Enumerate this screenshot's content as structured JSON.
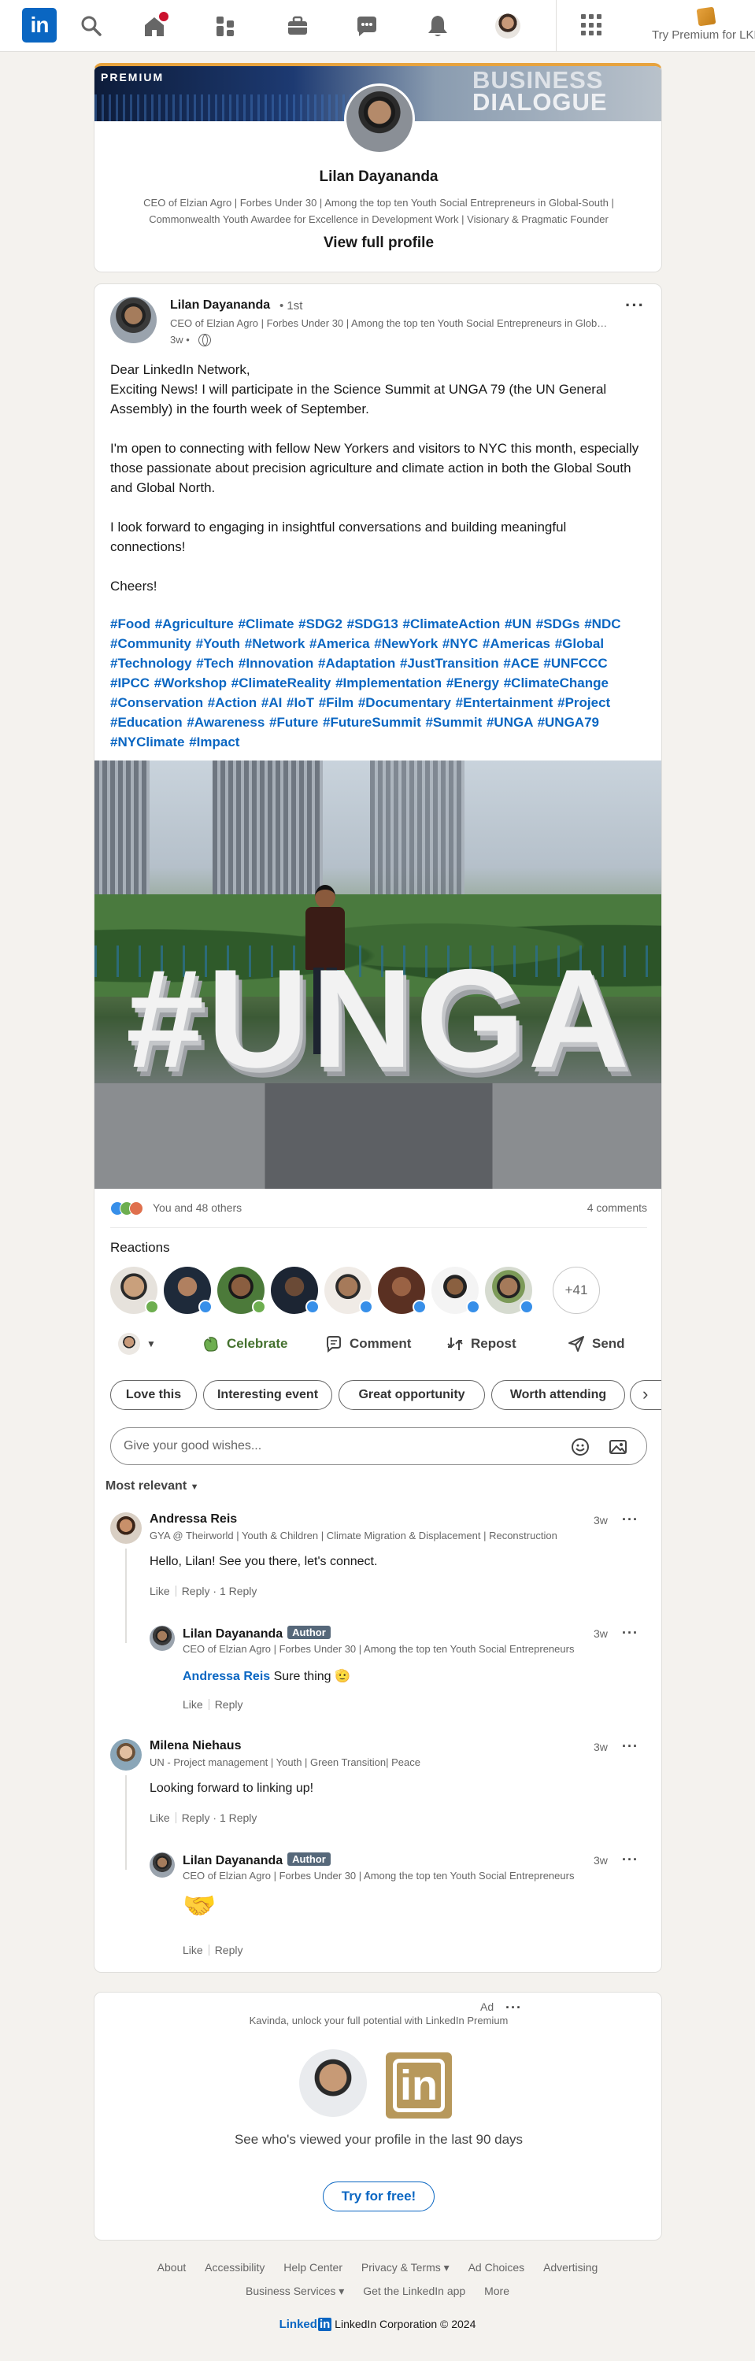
{
  "nav": {
    "logo": "in",
    "premium_cta": "Try Premium for LKR"
  },
  "profile": {
    "banner_label": "PREMIUM",
    "banner_line1": "BUSINESS",
    "banner_line2": "DIALOGUE",
    "name": "Lilan Dayananda",
    "headline": "CEO of Elzian Agro | Forbes Under 30 | Among the top ten Youth Social Entrepreneurs in Global-South | Commonwealth Youth Awardee for Excellence in Development Work | Visionary & Pragmatic Founder",
    "view_profile": "View full profile"
  },
  "post": {
    "author": "Lilan Dayananda",
    "degree": "• 1st",
    "headline": "CEO of Elzian Agro | Forbes Under 30 | Among the top ten Youth Social Entrepreneurs in Global-South",
    "time": "3w •",
    "text": "Dear LinkedIn Network,\nExciting News! I will participate in the Science Summit at UNGA 79 (the UN General Assembly) in the fourth week of September.\n\nI'm open to connecting with fellow New Yorkers and visitors to NYC this month, especially those passionate about precision agriculture and climate action in both the Global South and Global North.\n\nI look forward to engaging in insightful conversations and building meaningful connections!\n\nCheers!",
    "hashtags": "#Food #Agriculture #Climate #SDG2 #SDG13 #ClimateAction #UN #SDGs #NDC #Community #Youth #Network #America #NewYork #NYC #Americas #Global #Technology #Tech #Innovation #Adaptation #JustTransition #ACE #UNFCCC #IPCC #Workshop #ClimateReality #Implementation #Energy #ClimateChange #Conservation #Action #AI #IoT #Film #Documentary #Entertainment #Project #Education #Awareness #Future #FutureSummit #Summit #UNGA #UNGA79 #NYClimate #Impact",
    "image_text": "#UNGA",
    "reactions_summary": "You and 48 others",
    "comments_count": "4 comments",
    "reactions_title": "Reactions",
    "reactors_more": "+41"
  },
  "actions": {
    "celebrate": "Celebrate",
    "comment": "Comment",
    "repost": "Repost",
    "send": "Send"
  },
  "suggestions": [
    "Love this",
    "Interesting event",
    "Great opportunity",
    "Worth attending"
  ],
  "comment_box": {
    "placeholder": "Give your good wishes..."
  },
  "sort": "Most relevant",
  "comments": [
    {
      "name": "Andressa Reis",
      "sub": "GYA @ Theirworld | Youth & Children | Climate Migration & Displacement | Reconstruction",
      "time": "3w",
      "text": "Hello, Lilan! See you there, let's connect.",
      "like": "Like",
      "reply": "Reply",
      "replies_count": "1 Reply",
      "reply_item": {
        "name": "Lilan Dayananda",
        "badge": "Author",
        "sub": "CEO of Elzian Agro | Forbes Under 30 | Among the top ten Youth Social Entrepreneurs",
        "time": "3w",
        "mention": "Andressa Reis",
        "text": " Sure thing 🫡",
        "like": "Like",
        "reply": "Reply"
      }
    },
    {
      "name": "Milena Niehaus",
      "sub": "UN - Project management | Youth | Green Transition| Peace",
      "time": "3w",
      "text": "Looking forward to linking up!",
      "like": "Like",
      "reply": "Reply",
      "replies_count": "1 Reply",
      "reply_item": {
        "name": "Lilan Dayananda",
        "badge": "Author",
        "sub": "CEO of Elzian Agro | Forbes Under 30 | Among the top ten Youth Social Entrepreneurs",
        "time": "3w",
        "emoji": "🤝",
        "like": "Like",
        "reply": "Reply"
      }
    }
  ],
  "ad": {
    "label": "Ad",
    "text": "Kavinda, unlock your full potential with LinkedIn Premium",
    "logo": "in",
    "message": "See who's viewed your profile in the last 90 days",
    "button": "Try for free!"
  },
  "footer": {
    "row1": [
      "About",
      "Accessibility",
      "Help Center",
      "Privacy & Terms ▾",
      "Ad Choices",
      "Advertising"
    ],
    "row2": [
      "Business Services ▾",
      "Get the LinkedIn app",
      "More"
    ],
    "brand_word": "Linked",
    "brand_in": "in",
    "copyright": "LinkedIn Corporation © 2024"
  },
  "colors": {
    "brand": "#0a66c2",
    "premium": "#e7a33e",
    "celebrate": "#44712e",
    "notification": "#cb112d"
  }
}
